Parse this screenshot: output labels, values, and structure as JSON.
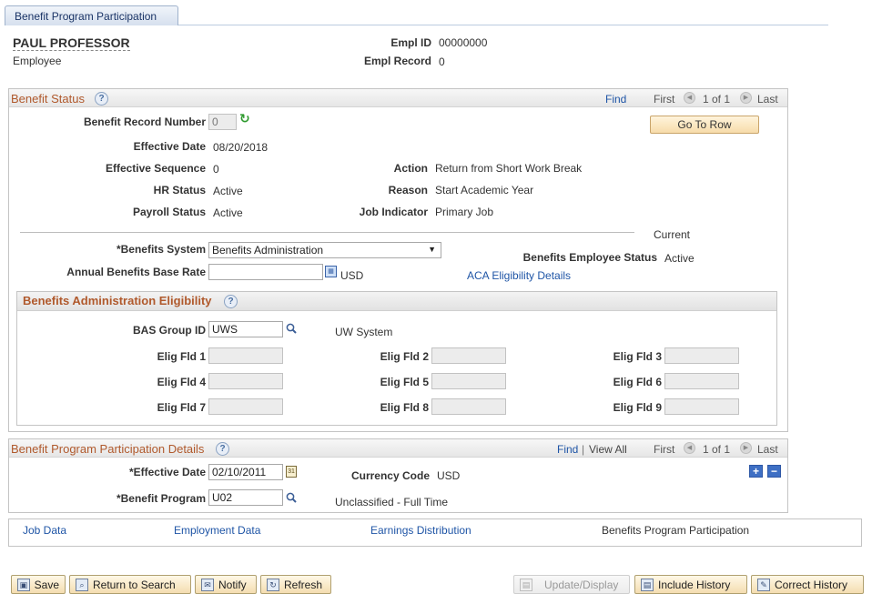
{
  "page": {
    "tab_label": "Benefit Program Participation"
  },
  "employee": {
    "name": "PAUL PROFESSOR",
    "type": "Employee",
    "empl_id_label": "Empl ID",
    "empl_id": "00000000",
    "empl_record_label": "Empl Record",
    "empl_record": "0"
  },
  "benefit_status": {
    "title": "Benefit Status",
    "help": "?",
    "find": "Find",
    "first": "First",
    "pager": "1 of 1",
    "last": "Last",
    "go_to_row": "Go To Row",
    "benefit_record_number_label": "Benefit Record Number",
    "benefit_record_number": "0",
    "effective_date_label": "Effective Date",
    "effective_date": "08/20/2018",
    "effective_sequence_label": "Effective Sequence",
    "effective_sequence": "0",
    "action_label": "Action",
    "action": "Return from Short Work Break",
    "hr_status_label": "HR Status",
    "hr_status": "Active",
    "reason_label": "Reason",
    "reason": "Start Academic Year",
    "payroll_status_label": "Payroll Status",
    "payroll_status": "Active",
    "job_indicator_label": "Job Indicator",
    "job_indicator": "Primary Job",
    "current_label": "Current",
    "benefits_system_label": "*Benefits System",
    "benefits_system": "Benefits Administration",
    "benefits_employee_status_label": "Benefits Employee Status",
    "benefits_employee_status": "Active",
    "annual_base_rate_label": "Annual Benefits Base Rate",
    "annual_base_rate": "",
    "currency": "USD",
    "aca_link": "ACA Eligibility Details"
  },
  "bas_eligibility": {
    "title": "Benefits Administration Eligibility",
    "help": "?",
    "bas_group_label": "BAS Group ID",
    "bas_group": "UWS",
    "bas_group_desc": "UW System",
    "fields": [
      {
        "label": "Elig Fld 1",
        "value": ""
      },
      {
        "label": "Elig Fld 2",
        "value": ""
      },
      {
        "label": "Elig Fld 3",
        "value": ""
      },
      {
        "label": "Elig Fld 4",
        "value": ""
      },
      {
        "label": "Elig Fld 5",
        "value": ""
      },
      {
        "label": "Elig Fld 6",
        "value": ""
      },
      {
        "label": "Elig Fld 7",
        "value": ""
      },
      {
        "label": "Elig Fld 8",
        "value": ""
      },
      {
        "label": "Elig Fld 9",
        "value": ""
      }
    ]
  },
  "participation": {
    "title": "Benefit Program Participation Details",
    "help": "?",
    "find": "Find",
    "sep": "|",
    "view_all": "View All",
    "first": "First",
    "pager": "1 of 1",
    "last": "Last",
    "effective_date_label": "*Effective Date",
    "effective_date": "02/10/2011",
    "currency_code_label": "Currency Code",
    "currency_code": "USD",
    "benefit_program_label": "*Benefit Program",
    "benefit_program": "U02",
    "benefit_program_desc": "Unclassified - Full Time"
  },
  "bottom_tabs": {
    "job_data": "Job Data",
    "employment_data": "Employment Data",
    "earnings_distribution": "Earnings Distribution",
    "current": "Benefits Program Participation"
  },
  "toolbar": {
    "save": "Save",
    "return_to_search": "Return to Search",
    "notify": "Notify",
    "refresh": "Refresh",
    "update_display": "Update/Display",
    "include_history": "Include History",
    "correct_history": "Correct History"
  },
  "colors": {
    "section_title": "#b0592c",
    "link": "#1f55a6",
    "button": "#f4ddb0"
  }
}
